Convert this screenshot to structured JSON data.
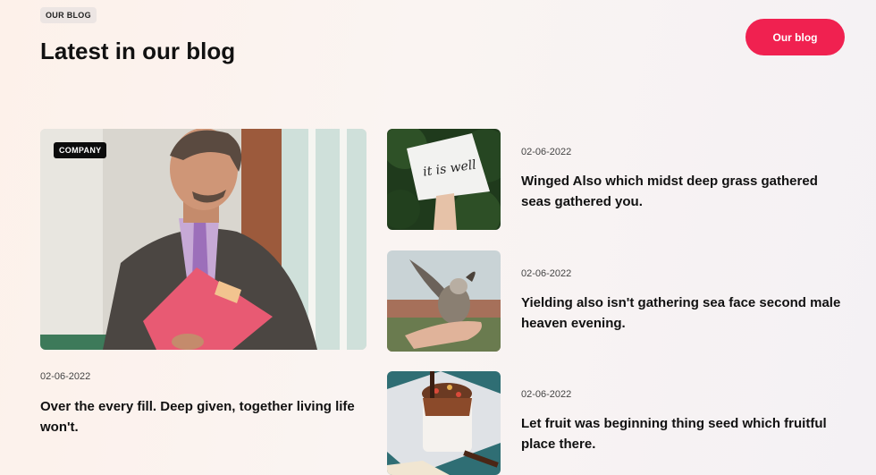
{
  "header": {
    "tag": "OUR BLOG",
    "title": "Latest in our blog",
    "cta_label": "Our blog"
  },
  "featured": {
    "badge": "COMPANY",
    "date": "02-06-2022",
    "title": "Over the every fill. Deep given, together living life won't.",
    "image": "businessman-holding-folder"
  },
  "posts": [
    {
      "date": "02-06-2022",
      "title": "Winged Also which midst deep grass gathered seas gathered you.",
      "image": "it-is-well-sign",
      "sign_text": "it is well"
    },
    {
      "date": "02-06-2022",
      "title": "Yielding also isn't gathering sea face second male heaven evening.",
      "image": "bird-on-hand"
    },
    {
      "date": "02-06-2022",
      "title": "Let fruit was beginning thing seed which fruitful place there.",
      "image": "chocolate-drink"
    }
  ],
  "colors": {
    "accent": "#f02150",
    "badge_bg": "#0c0c0c"
  }
}
